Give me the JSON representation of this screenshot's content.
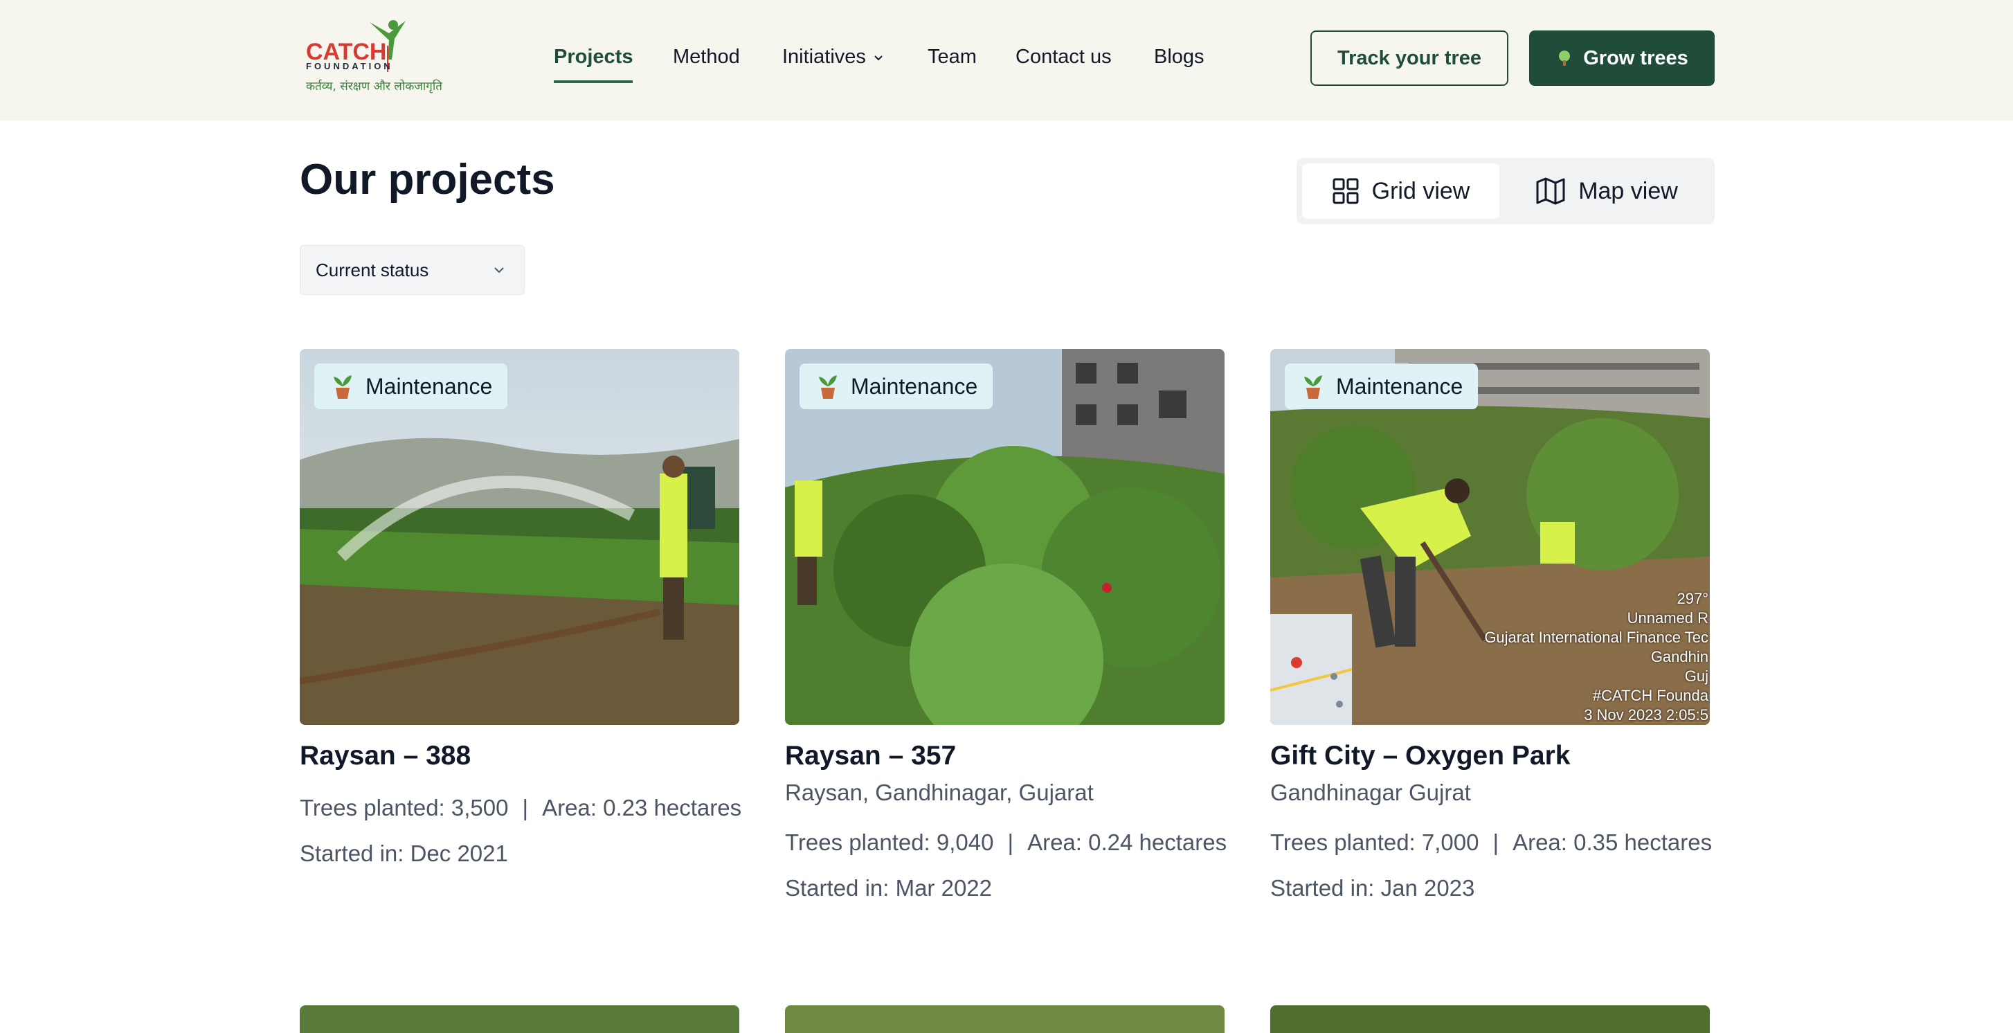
{
  "brand": {
    "name": "CATCH",
    "sub": "FOUNDATION",
    "tagline": "कर्तव्य, संरक्षण और लोकजागृति",
    "colors": {
      "primary": "#1f4d3a",
      "logo_red": "#d93a31",
      "logo_green": "#4a9a3c",
      "badge_bg": "#dff3f6",
      "header_bg": "#f6f6ef"
    }
  },
  "nav": {
    "items": [
      "Projects",
      "Method",
      "Initiatives",
      "Team",
      "Contact us",
      "Blogs"
    ],
    "active": "Projects"
  },
  "header_buttons": {
    "track": "Track your tree",
    "grow": "Grow trees"
  },
  "page": {
    "title": "Our projects",
    "views": {
      "grid": "Grid view",
      "map": "Map view",
      "selected": "grid"
    },
    "filter_label": "Current status"
  },
  "projects": [
    {
      "status": "Maintenance",
      "title": "Raysan – 388",
      "location": "",
      "trees": "Trees planted: 3,500",
      "area": "Area: 0.23 hectares",
      "started": "Started in: Dec 2021"
    },
    {
      "status": "Maintenance",
      "title": "Raysan – 357",
      "location": "Raysan, Gandhinagar, Gujarat",
      "trees": "Trees planted: 9,040",
      "area": "Area: 0.24 hectares",
      "started": "Started in: Mar 2022"
    },
    {
      "status": "Maintenance",
      "title": "Gift City – Oxygen Park",
      "location": "Gandhinagar Gujrat",
      "trees": "Trees planted: 7,000",
      "area": "Area: 0.35 hectares",
      "started": "Started in: Jan 2023",
      "photo_overlay": [
        "297°",
        "Unnamed R",
        "Gujarat International Finance Tec",
        "Gandhin",
        "Guj",
        "#CATCH Founda",
        "3 Nov 2023 2:05:5"
      ]
    }
  ],
  "icons": {
    "nav_dropdown": "chevron-down-icon",
    "grow": "tree-icon",
    "grid_view": "grid-icon",
    "map_view": "map-icon",
    "filter": "chevron-down-icon",
    "badge": "potted-plant-icon"
  }
}
